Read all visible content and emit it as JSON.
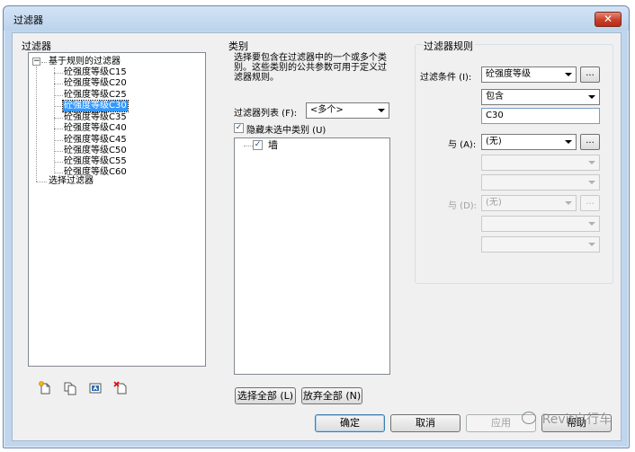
{
  "window": {
    "title": "过滤器",
    "close_label": "✕"
  },
  "filters_panel": {
    "title": "过滤器",
    "root_label": "基于规则的过滤器",
    "root_expander": "−",
    "items": [
      "砼强度等级C15",
      "砼强度等级C20",
      "砼强度等级C25",
      "砼强度等级C30",
      "砼强度等级C35",
      "砼强度等级C40",
      "砼强度等级C45",
      "砼强度等级C50",
      "砼强度等级C55",
      "砼强度等级C60"
    ],
    "selected_item": "砼强度等级C30",
    "selection_filter_label": "选择过滤器"
  },
  "categories_panel": {
    "title": "类别",
    "description": "选择要包含在过滤器中的一个或多个类别。这些类别的公共参数可用于定义过滤器规则。",
    "filter_list_label": "过滤器列表 (F):",
    "filter_list_value": "<多个>",
    "hide_unchecked_label": "隐藏未选中类别 (U)",
    "hide_unchecked_checked": "✓",
    "category_item": "墙",
    "category_checked": "✓",
    "select_all_label": "选择全部 (L)",
    "deselect_all_label": "放弃全部 (N)"
  },
  "rules_panel": {
    "title": "过滤器规则",
    "condition_label": "过滤条件 (I):",
    "condition_value": "砼强度等级",
    "operator_value": "包含",
    "value_text": "C30",
    "and1_label": "与 (A):",
    "and1_value": "(无)",
    "and2_label": "与 (D):",
    "and2_value": "(无)",
    "ellipsis": "..."
  },
  "footer": {
    "ok_label": "确定",
    "cancel_label": "取消",
    "apply_label": "应用",
    "help_label": "帮助",
    "watermark": "Revit自行车"
  }
}
